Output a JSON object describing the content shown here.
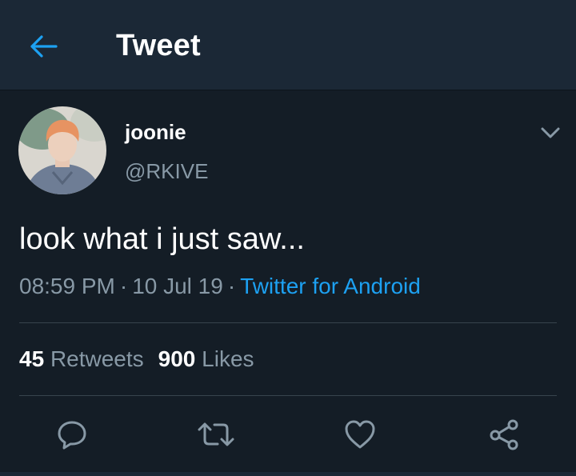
{
  "header": {
    "title": "Tweet",
    "back_icon": "arrow-left-icon"
  },
  "tweet": {
    "author": {
      "name": "joonie",
      "handle": "@RKIVE"
    },
    "menu_icon": "chevron-down-icon",
    "text": "look what i just saw...",
    "time": "08:59 PM",
    "date": "10 Jul 19",
    "separator": "·",
    "source": "Twitter for Android",
    "stats": {
      "retweets_count": "45",
      "retweets_label": "Retweets",
      "likes_count": "900",
      "likes_label": "Likes"
    },
    "actions": [
      "reply-icon",
      "retweet-icon",
      "like-icon",
      "share-icon"
    ]
  },
  "colors": {
    "background": "#141d26",
    "header_background": "#1b2836",
    "accent": "#1da1f2",
    "secondary_text": "#8899a6",
    "primary_text": "#ffffff"
  }
}
